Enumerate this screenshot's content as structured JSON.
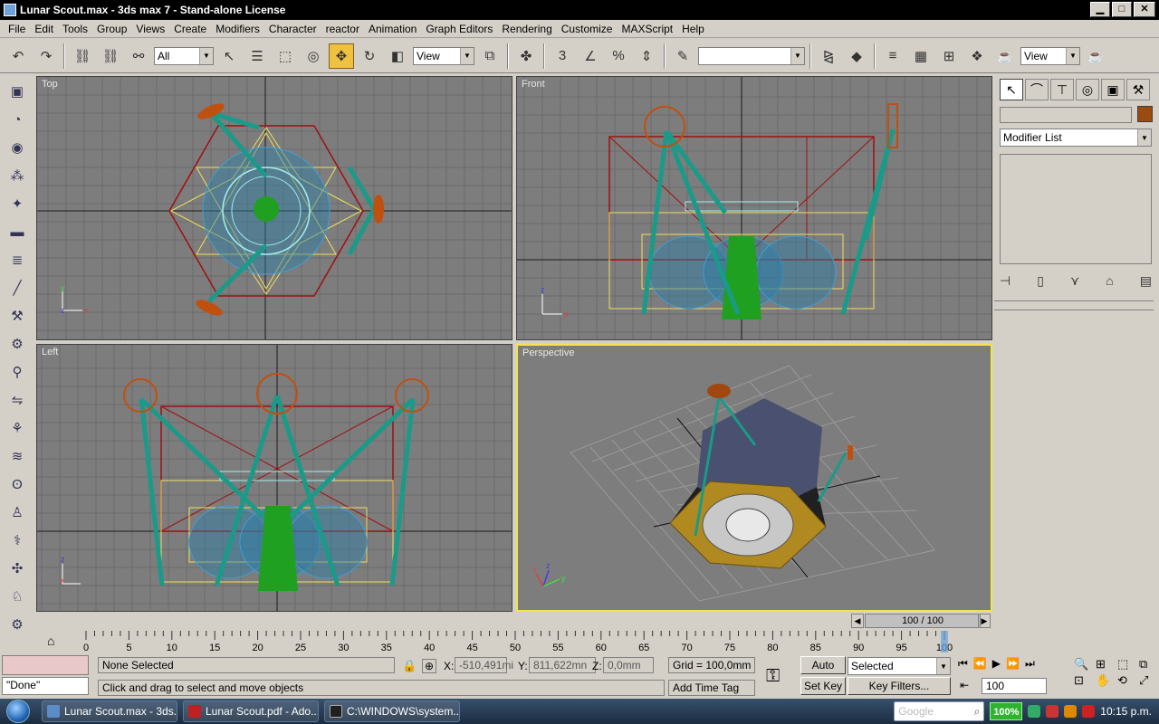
{
  "window": {
    "title": "Lunar Scout.max - 3ds max 7 - Stand-alone License",
    "minimize": "▁",
    "maximize": "□",
    "close": "✕"
  },
  "menu": [
    "File",
    "Edit",
    "Tools",
    "Group",
    "Views",
    "Create",
    "Modifiers",
    "Character",
    "reactor",
    "Animation",
    "Graph Editors",
    "Rendering",
    "Customize",
    "MAXScript",
    "Help"
  ],
  "toolbar": {
    "selection_filter": "All",
    "ref_coord": "View",
    "named_selection": "",
    "render_view": "View",
    "snap_label": "3",
    "percent_label": "%"
  },
  "viewports": {
    "top": "Top",
    "front": "Front",
    "left": "Left",
    "perspective": "Perspective"
  },
  "axis_labels": {
    "x": "x",
    "y": "y",
    "z": "z"
  },
  "command_panel": {
    "object_name": "",
    "modifier_list": "Modifier List"
  },
  "time": {
    "frame_display": "100 / 100",
    "ticks": [
      "0",
      "5",
      "10",
      "15",
      "20",
      "25",
      "30",
      "35",
      "40",
      "45",
      "50",
      "55",
      "60",
      "65",
      "70",
      "75",
      "80",
      "85",
      "90",
      "95",
      "100"
    ],
    "current_frame": 100
  },
  "status": {
    "maxscript": "\"Done\"",
    "selection": "None Selected",
    "prompt": "Click and drag to select and move objects",
    "x_label": "X:",
    "x_value": "-510,491mi",
    "y_label": "Y:",
    "y_value": "811,622mn",
    "z_label": "Z:",
    "z_value": "0,0mm",
    "grid": "Grid = 100,0mm",
    "add_time_tag": "Add Time Tag",
    "auto_key": "Auto Key",
    "set_key": "Set Key",
    "key_mode": "Selected",
    "key_filters": "Key Filters...",
    "frame_field": "100"
  },
  "taskbar": {
    "items": [
      {
        "label": "Lunar Scout.max - 3ds...",
        "color": "#5b8cc8"
      },
      {
        "label": "Lunar Scout.pdf - Ado...",
        "color": "#c02020"
      },
      {
        "label": "C:\\WINDOWS\\system...",
        "color": "#202020"
      }
    ],
    "search_placeholder": "Google",
    "battery": "100%",
    "clock": "10:15 p.m."
  },
  "colors": {
    "viewport_bg": "#7d7d7d",
    "grid": "#6a6a6a",
    "wire_red": "#a01010",
    "wire_yellow": "#f0e060",
    "teal": "#1a9a88",
    "blue_wire": "#2a8ac8",
    "green": "#20a020",
    "orange": "#c05010",
    "active_border": "#f2e44a"
  }
}
